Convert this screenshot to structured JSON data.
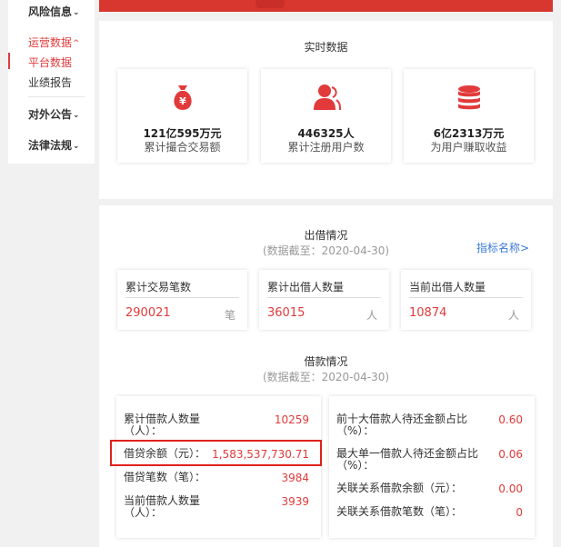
{
  "sidebar": {
    "risk_info": "风险信息",
    "operations": "运营数据",
    "platform_data": "平台数据",
    "performance_report": "业绩报告",
    "announcements": "对外公告",
    "regulations": "法律法规",
    "chevron_down": "⌄",
    "chevron_up": "^"
  },
  "realtime": {
    "title": "实时数据",
    "cards": [
      {
        "value": "121亿595万元",
        "label": "累计撮合交易额"
      },
      {
        "value": "446325人",
        "label": "累计注册用户数"
      },
      {
        "value": "6亿2313万元",
        "label": "为用户赚取收益"
      }
    ]
  },
  "lending": {
    "title": "出借情况",
    "subtitle": "(数据截至：2020-04-30)",
    "indicator_link": "指标名称>",
    "metrics": [
      {
        "label": "累计交易笔数",
        "value": "290021",
        "unit": "笔"
      },
      {
        "label": "累计出借人数量",
        "value": "36015",
        "unit": "人"
      },
      {
        "label": "当前出借人数量",
        "value": "10874",
        "unit": "人"
      }
    ]
  },
  "borrowing": {
    "title": "借款情况",
    "subtitle": "(数据截至：2020-04-30)",
    "left": [
      {
        "label_line1": "累计借款人数量",
        "label_line2": "（人）：",
        "value": "10259"
      },
      {
        "label_line1": "借贷余额（元）：",
        "label_line2": "",
        "value": "1,583,537,730.71"
      },
      {
        "label_line1": "借贷笔数（笔）：",
        "label_line2": "",
        "value": "3984"
      },
      {
        "label_line1": "当前借款人数量",
        "label_line2": "（人）：",
        "value": "3939"
      }
    ],
    "right": [
      {
        "label_line1": "前十大借款人待还金额占比",
        "label_line2": "（%）：",
        "value": "0.60"
      },
      {
        "label_line1": "最大单一借款人待还金额占比",
        "label_line2": "（%）：",
        "value": "0.06"
      },
      {
        "label_line1": "关联关系借款余额（元）：",
        "label_line2": "",
        "value": "0.00"
      },
      {
        "label_line1": "关联关系借款笔数（笔）：",
        "label_line2": "",
        "value": "0"
      }
    ]
  },
  "colors": {
    "accent": "#e23a3a",
    "header_red": "#d8372f",
    "link": "#3a7bd5",
    "highlight_border": "#e0201b"
  }
}
